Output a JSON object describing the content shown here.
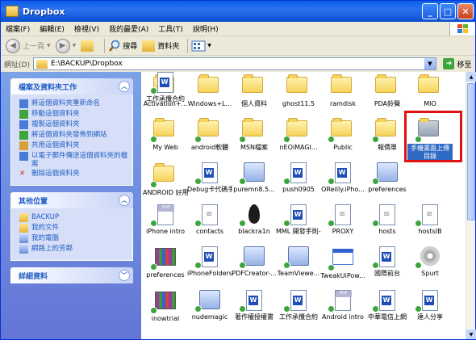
{
  "window": {
    "title": "Dropbox",
    "buttons": {
      "minimize": "_",
      "maximize": "□",
      "close": "✕"
    }
  },
  "menu": [
    "檔案(F)",
    "編輯(E)",
    "檢視(V)",
    "我的最愛(A)",
    "工具(T)",
    "說明(H)"
  ],
  "toolbar": {
    "back": "上一頁",
    "search": "搜尋",
    "folders": "資料夾"
  },
  "address": {
    "label": "網址(D)",
    "path": "E:\\BACKUP\\Dropbox",
    "go": "移至"
  },
  "tasks": {
    "title": "檔案及資料夾工作",
    "items": [
      "將這個資料夾重新命名",
      "移動這個資料夾",
      "複製這個資料夾",
      "將這個資料夾發佈到網站",
      "共用這個資料夾",
      "以電子郵件傳送這個資料夾的檔案",
      "刪除這個資料夾"
    ]
  },
  "places": {
    "title": "其他位置",
    "items": [
      "BACKUP",
      "我的文件",
      "我的電腦",
      "網路上的芳鄰"
    ]
  },
  "details": {
    "title": "詳細資料"
  },
  "files": [
    {
      "label": "Activation+...",
      "type": "folder"
    },
    {
      "label": "Windows+L...",
      "type": "folder"
    },
    {
      "label": "個人資料",
      "type": "folder"
    },
    {
      "label": "ghost11.5",
      "type": "folder"
    },
    {
      "label": "ramdisk",
      "type": "folder"
    },
    {
      "label": "PDA鈴聲",
      "type": "folder"
    },
    {
      "label": "MIO",
      "type": "folder"
    },
    {
      "label": "My Web",
      "type": "folder"
    },
    {
      "label": "android軟體",
      "type": "folder"
    },
    {
      "label": "MSN檔案",
      "type": "folder"
    },
    {
      "label": "nEOiMAGI...",
      "type": "folder"
    },
    {
      "label": "Public",
      "type": "folder"
    },
    {
      "label": "報價單",
      "type": "folder"
    },
    {
      "label": "手機畫面上傳目錄",
      "type": "folder",
      "selected": true
    },
    {
      "label": "ANDROID 好用軟體200...",
      "type": "folder"
    },
    {
      "label": "Debug卡代碼手冊",
      "type": "word"
    },
    {
      "label": "puremn8.5...",
      "type": "exe"
    },
    {
      "label": "push0905",
      "type": "word"
    },
    {
      "label": "OReilly.iPho...",
      "type": "word"
    },
    {
      "label": "preferences",
      "type": "exe"
    },
    {
      "label": "",
      "type": "none"
    },
    {
      "label": "iPhone intro",
      "type": "pdf"
    },
    {
      "label": "contacts",
      "type": "txt"
    },
    {
      "label": "blackra1n",
      "type": "drop"
    },
    {
      "label": "MML 開發手則-20091217",
      "type": "word"
    },
    {
      "label": "PROXY",
      "type": "txt"
    },
    {
      "label": "hosts",
      "type": "txt"
    },
    {
      "label": "hostsIB",
      "type": "txt"
    },
    {
      "label": "preferences",
      "type": "rar"
    },
    {
      "label": "iPhoneFolders",
      "type": "word"
    },
    {
      "label": "PDFCreator-...",
      "type": "exe"
    },
    {
      "label": "TeamViewe...",
      "type": "exe"
    },
    {
      "label": "TweakUiPow...",
      "type": "win"
    },
    {
      "label": "國際前台",
      "type": "word"
    },
    {
      "label": "Spurt",
      "type": "cd"
    },
    {
      "label": "inowtrial",
      "type": "rar"
    },
    {
      "label": "nudemagic",
      "type": "exe"
    },
    {
      "label": "著作權授權書",
      "type": "word"
    },
    {
      "label": "工作承攬合約",
      "type": "word"
    },
    {
      "label": "Android intro",
      "type": "pdf"
    },
    {
      "label": "中華電信上網",
      "type": "word"
    },
    {
      "label": "達人分享",
      "type": "word"
    },
    {
      "label": "工作承攬合約",
      "type": "word"
    }
  ]
}
